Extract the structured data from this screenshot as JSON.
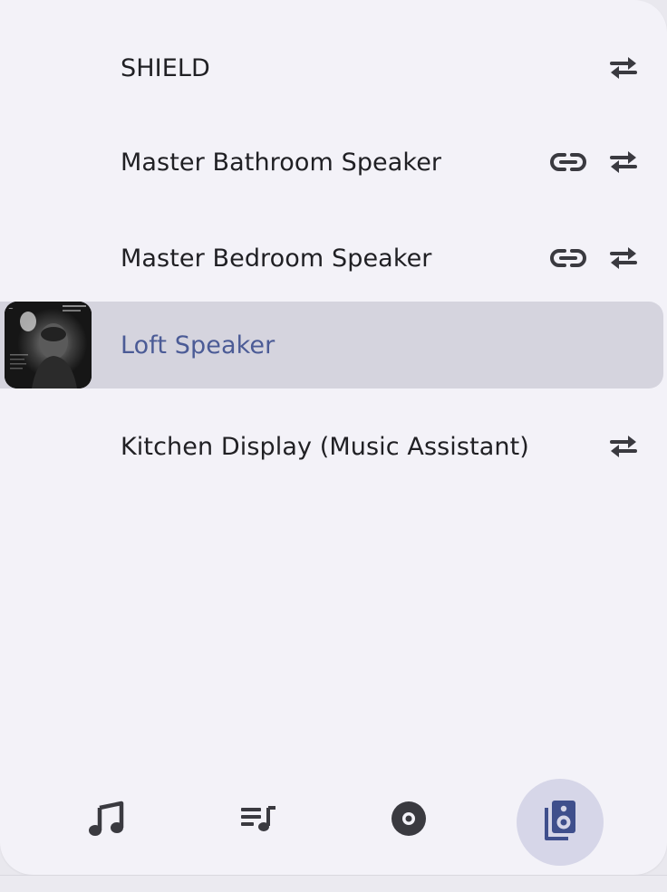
{
  "players": [
    {
      "name": "SHIELD",
      "has_link": false,
      "has_transfer": true,
      "active": false
    },
    {
      "name": "Master Bathroom Speaker",
      "has_link": true,
      "has_transfer": true,
      "active": false
    },
    {
      "name": "Master Bedroom Speaker",
      "has_link": true,
      "has_transfer": true,
      "active": false
    },
    {
      "name": "Loft Speaker",
      "has_link": false,
      "has_transfer": false,
      "active": true
    },
    {
      "name": "Kitchen Display (Music Assistant)",
      "has_link": false,
      "has_transfer": true,
      "active": false
    }
  ],
  "icons": {
    "transfer": "swap-horizontal-icon",
    "link": "link-icon",
    "album_art": "album-art"
  },
  "nav": {
    "items": [
      {
        "icon": "music-note-icon"
      },
      {
        "icon": "playlist-icon"
      },
      {
        "icon": "album-disc-icon"
      },
      {
        "icon": "speaker-group-icon",
        "selected": true
      }
    ]
  },
  "colors": {
    "background": "#f3f2f8",
    "active_row": "#d5d4de",
    "active_text": "#4b5b96",
    "selected_nav": "#d6d6e8",
    "icon": "#3a3a40"
  }
}
